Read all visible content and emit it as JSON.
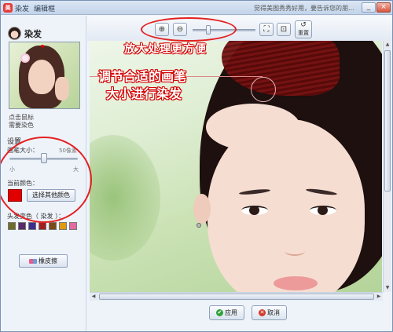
{
  "window": {
    "app_icon": "美",
    "title": "染发",
    "subtitle": "编辑框",
    "message": "觉得美图秀秀好用，要告诉您的朋...",
    "minimize_icon": "_",
    "close_icon": "×"
  },
  "left_panel": {
    "title": "染发",
    "hint": "点击鼠标 需要染色",
    "settings_label": "设置",
    "brush_size_label": "画笔大小：",
    "brush_size_value": "50像素",
    "brush_size_fraction": 0.5,
    "slider_min_label": "小",
    "slider_max_label": "大",
    "current_color_label": "当前颜色：",
    "current_color": "#e00000",
    "other_color_button": "选择其他颜色",
    "preset_label": "头发变色（ 染发 ）：",
    "preset_colors": [
      "#6e6e2a",
      "#5a2a6a",
      "#3a2f90",
      "#a01f1f",
      "#7a4a1a",
      "#e09a10",
      "#e46aa0"
    ],
    "eraser_button": "橡皮擦"
  },
  "toolbar": {
    "zoom_in_icon": "⊕",
    "zoom_out_icon": "⊖",
    "fit_icon": "⛶",
    "actual_size_icon": "⊡",
    "reset_icon": "↺",
    "reset_label": "重置",
    "zoom_tip": "放大处理更方便"
  },
  "canvas": {
    "brush_tip_line1": "调节合适的画笔",
    "brush_tip_line2": "大小进行染发"
  },
  "scroll": {
    "up": "▲",
    "down": "▼",
    "left": "◀",
    "right": "▶"
  },
  "footer": {
    "apply_icon": "✔",
    "apply_label": "应用",
    "cancel_icon": "✕",
    "cancel_label": "取消"
  },
  "colors": {
    "annotation_red": "#e42020",
    "dyed_hair": "#7a1212"
  }
}
